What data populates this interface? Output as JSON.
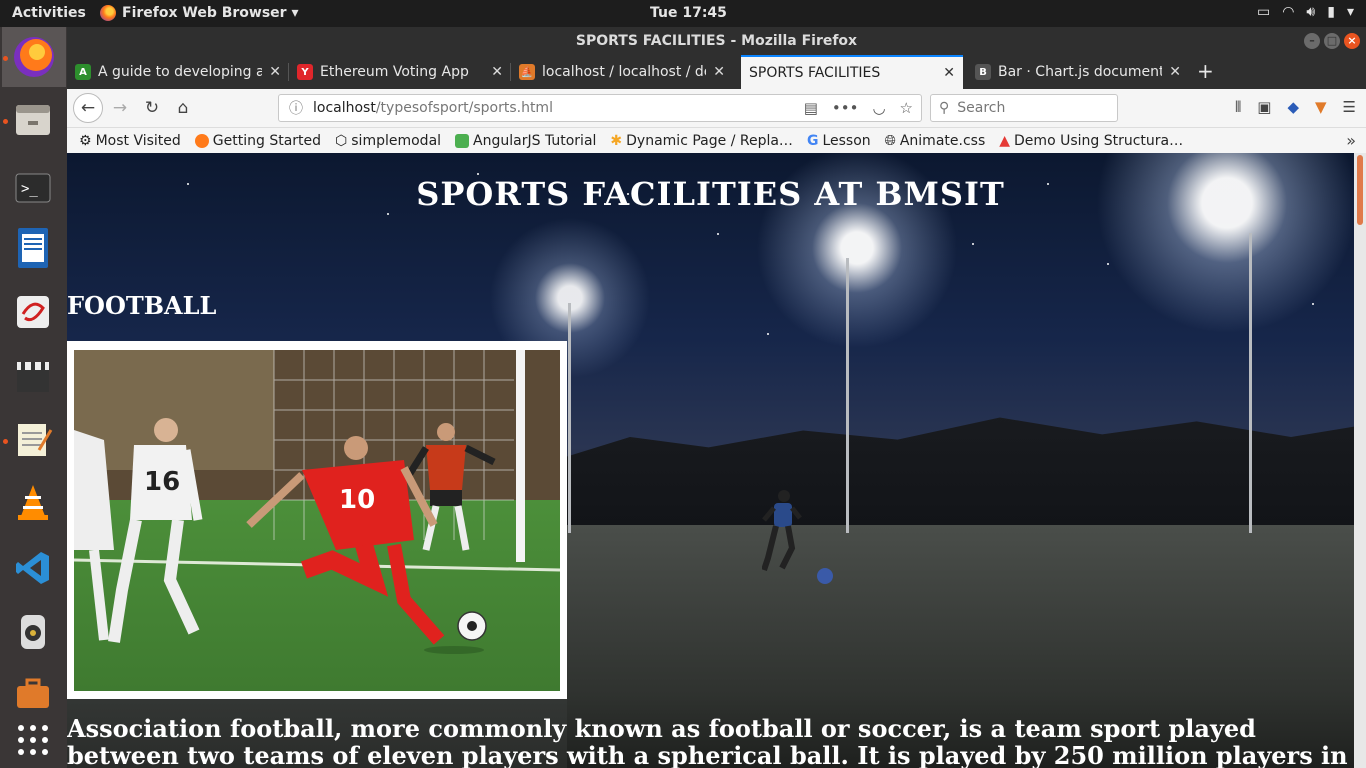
{
  "system": {
    "activities": "Activities",
    "app_menu": "Firefox Web Browser ▾",
    "clock": "Tue 17:45"
  },
  "window": {
    "title": "SPORTS FACILITIES - Mozilla Firefox"
  },
  "tabs": [
    {
      "label": "A guide to developing an",
      "favicon": "A",
      "color": "#2d8f2d"
    },
    {
      "label": "Ethereum Voting App",
      "favicon": "Y",
      "color": "#e0262b"
    },
    {
      "label": "localhost / localhost / de",
      "favicon": "⛵",
      "color": "#e07a2a"
    },
    {
      "label": "SPORTS FACILITIES",
      "favicon": "",
      "color": "#f5f5f5"
    },
    {
      "label": "Bar · Chart.js documenta",
      "favicon": "B",
      "color": "#555555"
    }
  ],
  "navbar": {
    "url_host": "localhost",
    "url_path": "/typesofsport/sports.html",
    "search_placeholder": "Search"
  },
  "bookmarks": [
    {
      "label": "Most Visited",
      "color": "#666666"
    },
    {
      "label": "Getting Started",
      "color": "#ff7a1a"
    },
    {
      "label": "simplemodal",
      "color": "#444444"
    },
    {
      "label": "AngularJS Tutorial",
      "color": "#4caf50"
    },
    {
      "label": "Dynamic Page / Repla…",
      "color": "#f5a623"
    },
    {
      "label": "Lesson",
      "color": "#4285f4"
    },
    {
      "label": "Animate.css",
      "color": "#444444"
    },
    {
      "label": "Demo Using Structura…",
      "color": "#e53935"
    }
  ],
  "page": {
    "title": "SPORTS FACILITIES AT BMSIT",
    "section_title": "FOOTBALL",
    "paragraph": "Association football, more commonly known as football or soccer, is a team sport played between two teams of eleven players with a spherical ball. It is played by 250 million players in"
  },
  "photo": {
    "jersey_number_1": "16",
    "jersey_number_2": "10"
  },
  "colors": {
    "accent": "#e95420",
    "tab_indicator": "#0a84ff"
  }
}
